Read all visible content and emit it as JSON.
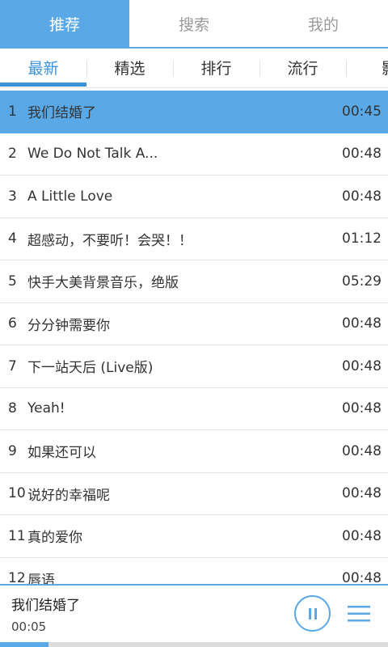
{
  "top_tabs": [
    {
      "label": "推荐",
      "active": true
    },
    {
      "label": "搜索",
      "active": false
    },
    {
      "label": "我的",
      "active": false
    }
  ],
  "sub_tabs": [
    {
      "label": "最新",
      "active": true
    },
    {
      "label": "精选",
      "active": false
    },
    {
      "label": "排行",
      "active": false
    },
    {
      "label": "流行",
      "active": false
    },
    {
      "label": "影",
      "active": false
    }
  ],
  "songs": [
    {
      "num": "1",
      "title": "我们结婚了",
      "time": "00:45"
    },
    {
      "num": "2",
      "title": "We Do Not Talk A...",
      "time": "00:48"
    },
    {
      "num": "3",
      "title": "A Little Love",
      "time": "00:48"
    },
    {
      "num": "4",
      "title": "超感动，不要听！会哭！！",
      "time": "01:12"
    },
    {
      "num": "5",
      "title": "快手大美背景音乐，绝版",
      "time": "05:29"
    },
    {
      "num": "6",
      "title": "分分钟需要你",
      "time": "00:48"
    },
    {
      "num": "7",
      "title": "下一站天后 (Live版)",
      "time": "00:48"
    },
    {
      "num": "8",
      "title": "Yeah!",
      "time": "00:48"
    },
    {
      "num": "9",
      "title": "如果还可以",
      "time": "00:48"
    },
    {
      "num": "10",
      "title": "说好的幸福呢",
      "time": "00:48"
    },
    {
      "num": "11",
      "title": "真的爱你",
      "time": "00:48"
    },
    {
      "num": "12",
      "title": "唇语",
      "time": "00:48"
    }
  ],
  "player": {
    "now_title": "我们结婚了",
    "current_time": "00:05",
    "pause_icon": "pause-icon",
    "menu_icon": "menu-icon",
    "progress": 0.125
  },
  "colors": {
    "accent": "#5aa9e6",
    "accent_text": "#3c93d8"
  }
}
